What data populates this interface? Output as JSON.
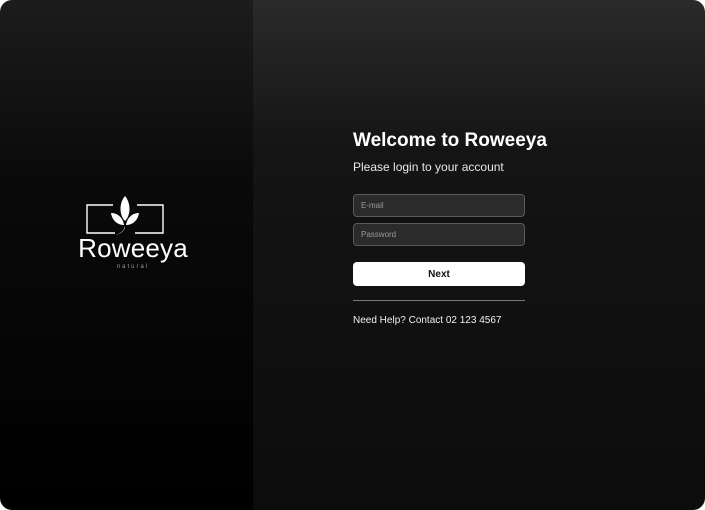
{
  "brand": {
    "name": "Roweeya",
    "tagline": "natural",
    "icon": "leaf-logo-icon"
  },
  "login": {
    "title": "Welcome to Roweeya",
    "subtitle": "Please login to your account",
    "email_placeholder": "E-mail",
    "password_placeholder": "Password",
    "next_label": "Next",
    "help_text": "Need Help? Contact 02 123 4567"
  },
  "colors": {
    "background": "#000000",
    "panel_top": "#2a2a2a",
    "accent_button": "#ffffff",
    "input_background": "#2b2b2b",
    "input_border": "#5a5a5a"
  }
}
